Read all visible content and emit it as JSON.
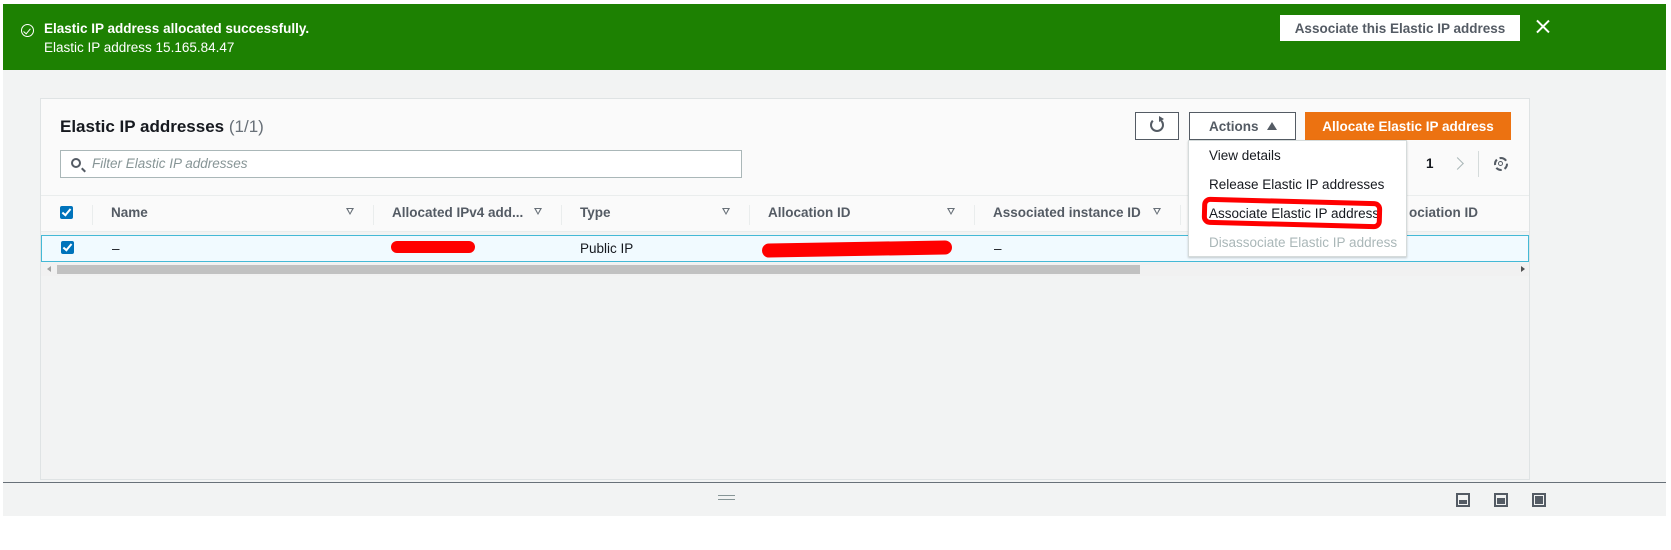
{
  "flash": {
    "title": "Elastic IP address allocated successfully.",
    "message": "Elastic IP address 15.165.84.47",
    "action_label": "Associate this Elastic IP address"
  },
  "header": {
    "title": "Elastic IP addresses",
    "count": "(1/1)",
    "search_placeholder": "Filter Elastic IP addresses",
    "actions_label": "Actions",
    "allocate_label": "Allocate Elastic IP address",
    "page_number": "1"
  },
  "table": {
    "columns": [
      "Name",
      "Allocated IPv4 add...",
      "Type",
      "Allocation ID",
      "Associated instance ID",
      "ociation ID"
    ],
    "rows": [
      {
        "name": "–",
        "type": "Public IP",
        "instance_id": "–"
      }
    ]
  },
  "actions_menu": {
    "items": [
      {
        "label": "View details",
        "enabled": true
      },
      {
        "label": "Release Elastic IP addresses",
        "enabled": true
      },
      {
        "label": "Associate Elastic IP address",
        "enabled": true
      },
      {
        "label": "Disassociate Elastic IP address",
        "enabled": false
      }
    ]
  },
  "colors": {
    "success": "#1d8102",
    "primary": "#ec7211",
    "checkbox": "#0073bb",
    "annotation": "#ff0000"
  }
}
